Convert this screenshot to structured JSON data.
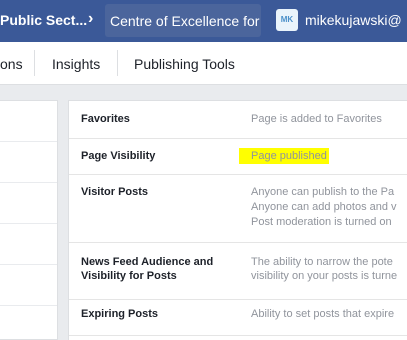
{
  "topbar": {
    "crumb1": "Public Sect...",
    "crumb2": "Centre of Excellence for",
    "avatar": "MK",
    "user": "mikekujawski@"
  },
  "navbar": {
    "tabs": [
      "ons",
      "Insights",
      "Publishing Tools"
    ]
  },
  "settings": {
    "rows": [
      {
        "label": "Favorites",
        "lines": [
          "Page is added to Favorites"
        ]
      },
      {
        "label": "Page Visibility",
        "lines": [
          "Page published"
        ]
      },
      {
        "label": "Visitor Posts",
        "lines": [
          "Anyone can publish to the Pa",
          "Anyone can add photos and v",
          "Post moderation is turned on"
        ]
      },
      {
        "label_lines": [
          "News Feed Audience and",
          "Visibility for Posts"
        ],
        "lines": [
          "The ability to narrow the pote",
          "visibility on your posts is turne"
        ]
      },
      {
        "label": "Expiring Posts",
        "lines": [
          "Ability to set posts that expire"
        ]
      }
    ]
  }
}
